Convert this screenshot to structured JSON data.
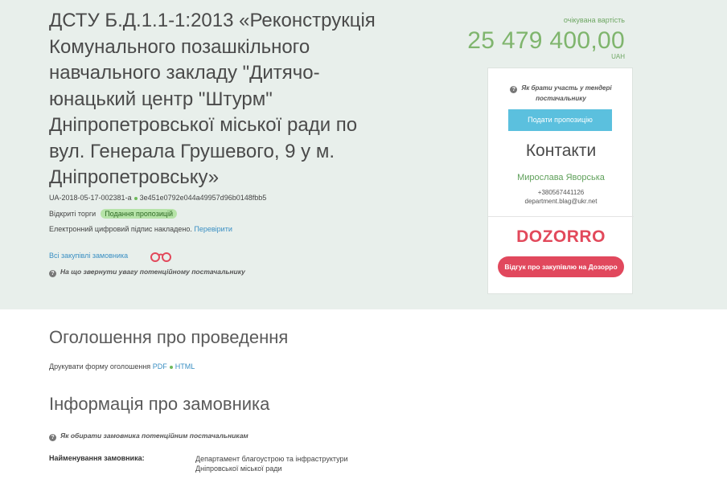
{
  "tender": {
    "title": "ДСТУ Б.Д.1.1-1:2013 «Реконструкція Комунального позашкільного навчального закладу \"Дитячо-юнацький центр \"Штурм\" Дніпропетровської міської ради по вул. Генерала Грушевого, 9 у м. Дніпропетровську»",
    "id": "UA-2018-05-17-002381-a",
    "hash": "3e451e0792e044a49957d96b0148fbb5",
    "procedure": "Відкриті торги",
    "status": "Подання пропозицій",
    "signature_text": "Електронний цифровий підпис накладено.",
    "signature_link": "Перевірити",
    "all_purchases_link": "Всі закупівлі замовника",
    "attention_text": "На що звернути увагу потенційному постачальнику"
  },
  "price": {
    "caption": "очікувана вартість",
    "amount": "25 479 400,00",
    "currency": "UAH"
  },
  "sidebar": {
    "how_to_participate": "Як брати участь у тендері постачальнику",
    "submit_button": "Подати пропозицію",
    "contacts_title": "Контакти",
    "contact_name": "Мирослава Яворська",
    "contact_phone": "+380567441126",
    "contact_email": "department.blag@ukr.net",
    "logo_text": "DOZORRO",
    "review_button": "Відгук про закупівлю на Дозорро"
  },
  "announcement": {
    "heading": "Оголошення про проведення",
    "print_text": "Друкувати форму оголошення",
    "pdf_link": "PDF",
    "html_link": "HTML"
  },
  "customer": {
    "heading": "Інформація про замовника",
    "hint": "Як обирати замовника потенційним постачальникам",
    "name_label": "Найменування замовника:",
    "name_value": "Департамент благоустрою та інфраструктури Дніпровської міської ради"
  },
  "colors": {
    "top_bg": "#e8efeb",
    "accent_green": "#7fb56d",
    "submit_blue": "#5bc0de",
    "dozorro_red": "#e1485d",
    "link_blue": "#3a8fc3"
  }
}
